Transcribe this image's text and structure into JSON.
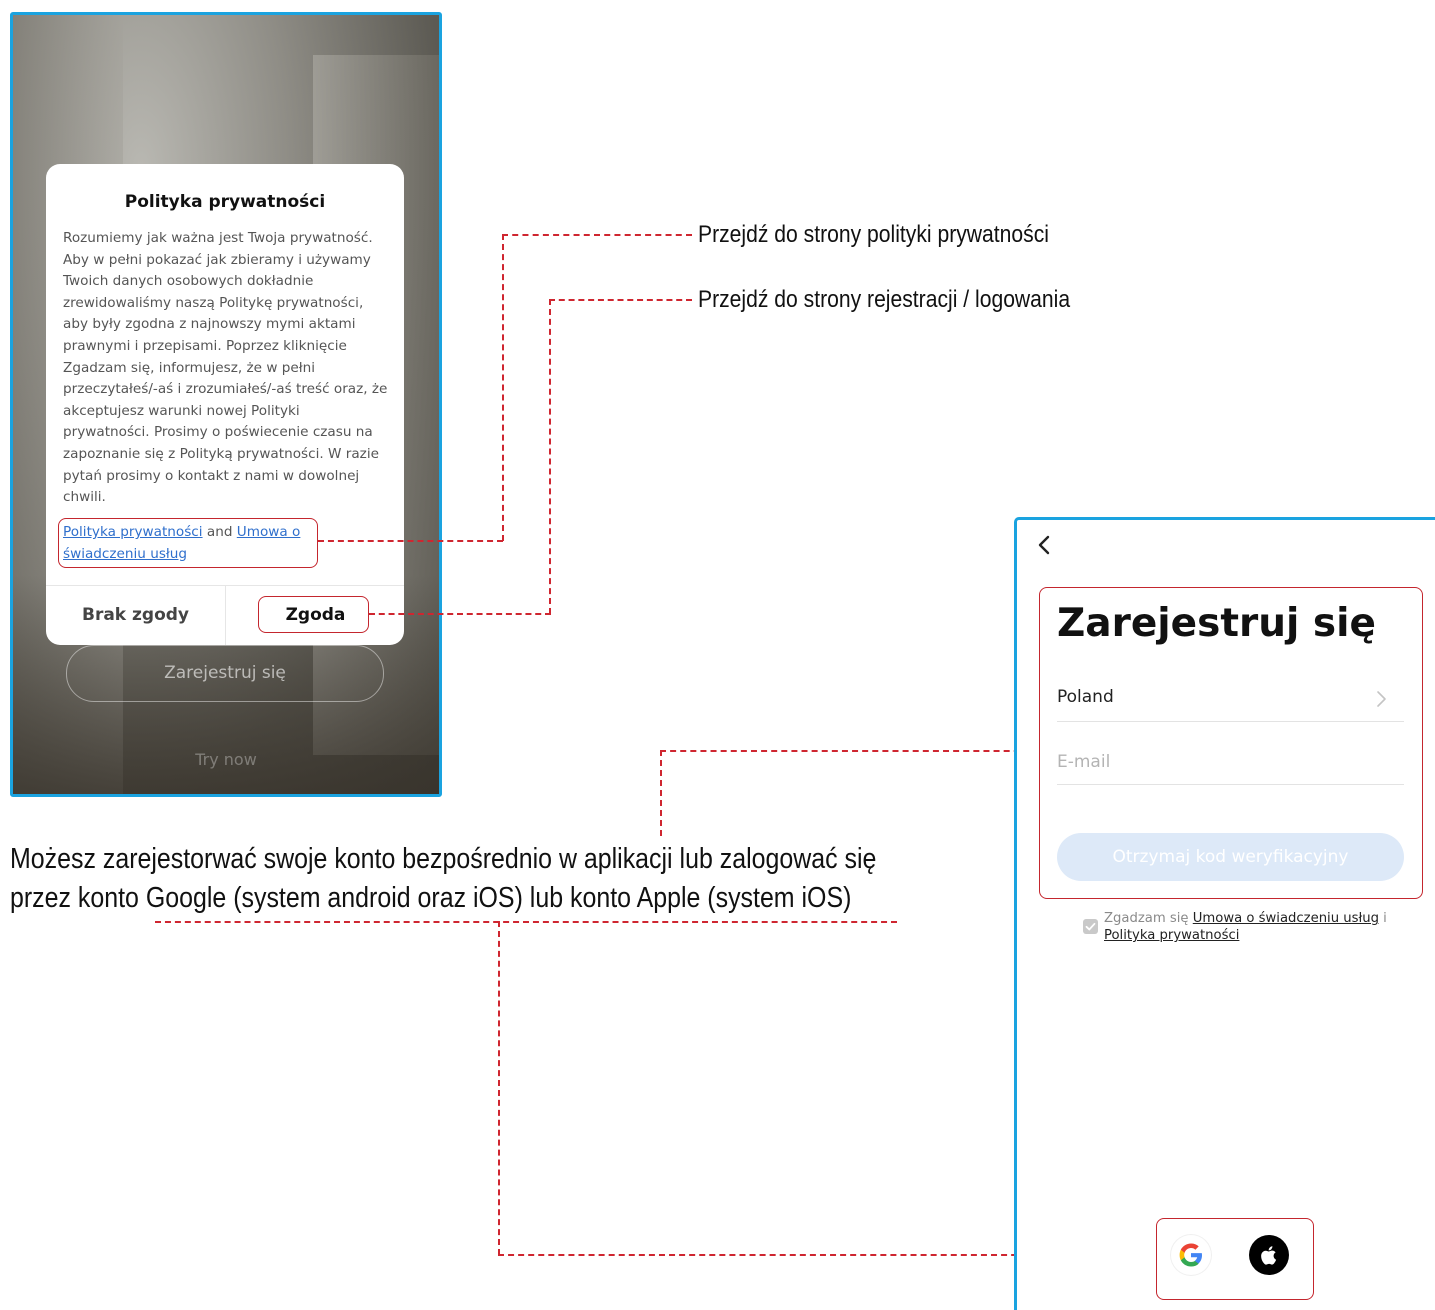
{
  "privacy_screen": {
    "dialog": {
      "title": "Polityka prywatności",
      "body": "Rozumiemy jak ważna jest Twoja prywatność. Aby w pełni pokazać jak zbieramy i używamy Twoich danych osobowych dokładnie zrewidowaliśmy naszą Politykę prywatności, aby były zgodna z najnowszy mymi aktami prawnymi i przepisami. Poprzez kliknięcie Zgadzam się, informujesz, że w pełni przeczytałeś/-aś i zrozumiałeś/-aś treść oraz, że akceptujesz warunki nowej Polityki prywatności. Prosimy o poświecenie czasu na zapoznanie się z Polityką prywatności. W razie pytań prosimy o kontakt z nami w dowolnej chwili.",
      "link_privacy": "Polityka prywatności",
      "link_connector": " and ",
      "link_terms": "Umowa o świadczeniu usług",
      "decline_label": "Brak zgody",
      "accept_label": "Zgoda"
    },
    "register_button": "Zarejestruj się",
    "try_now": "Try now"
  },
  "annotations": {
    "privacy_link_note": "Przejdź do strony polityki prywatności",
    "accept_note": "Przejdź do strony rejestracji / logowania",
    "register_note": "Możesz zarejestorwać swoje konto bezpośrednio w aplikacji lub zalogować się przez konto Google (system android oraz iOS) lub konto Apple (system iOS)"
  },
  "register_screen": {
    "title": "Zarejestruj się",
    "country": "Poland",
    "email_placeholder": "E-mail",
    "get_code_button": "Otrzymaj kod weryfikacyjny",
    "agree_prefix": "Zgadzam się ",
    "agree_terms": "Umowa o świadczeniu usług",
    "agree_and": " i ",
    "agree_privacy": "Polityka prywatności",
    "social": [
      "google-icon",
      "apple-icon"
    ]
  },
  "colors": {
    "frame_border": "#1aa3e0",
    "highlight": "#c4262e",
    "link": "#2f6fcc",
    "button_disabled": "#dde9f8"
  }
}
